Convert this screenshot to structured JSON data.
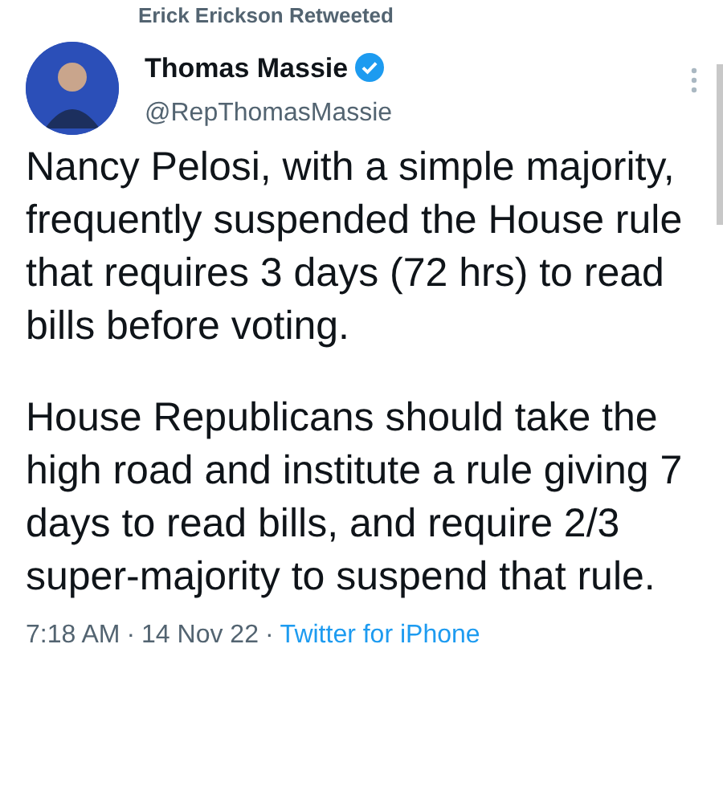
{
  "retweet_header": "Erick Erickson Retweeted",
  "author": {
    "name": "Thomas Massie",
    "verified": true,
    "handle": "@RepThomasMassie"
  },
  "paragraphs": [
    "Nancy Pelosi, with a simple majority, frequently suspended the House rule that requires 3 days (72 hrs) to read bills before voting.",
    "House Republicans should take the high road and institute a rule giving 7 days to read bills, and require 2/3 super-majority to suspend that rule."
  ],
  "meta": {
    "time": "7:18 AM",
    "separator": "·",
    "date": "14 Nov 22",
    "source": "Twitter for iPhone"
  }
}
